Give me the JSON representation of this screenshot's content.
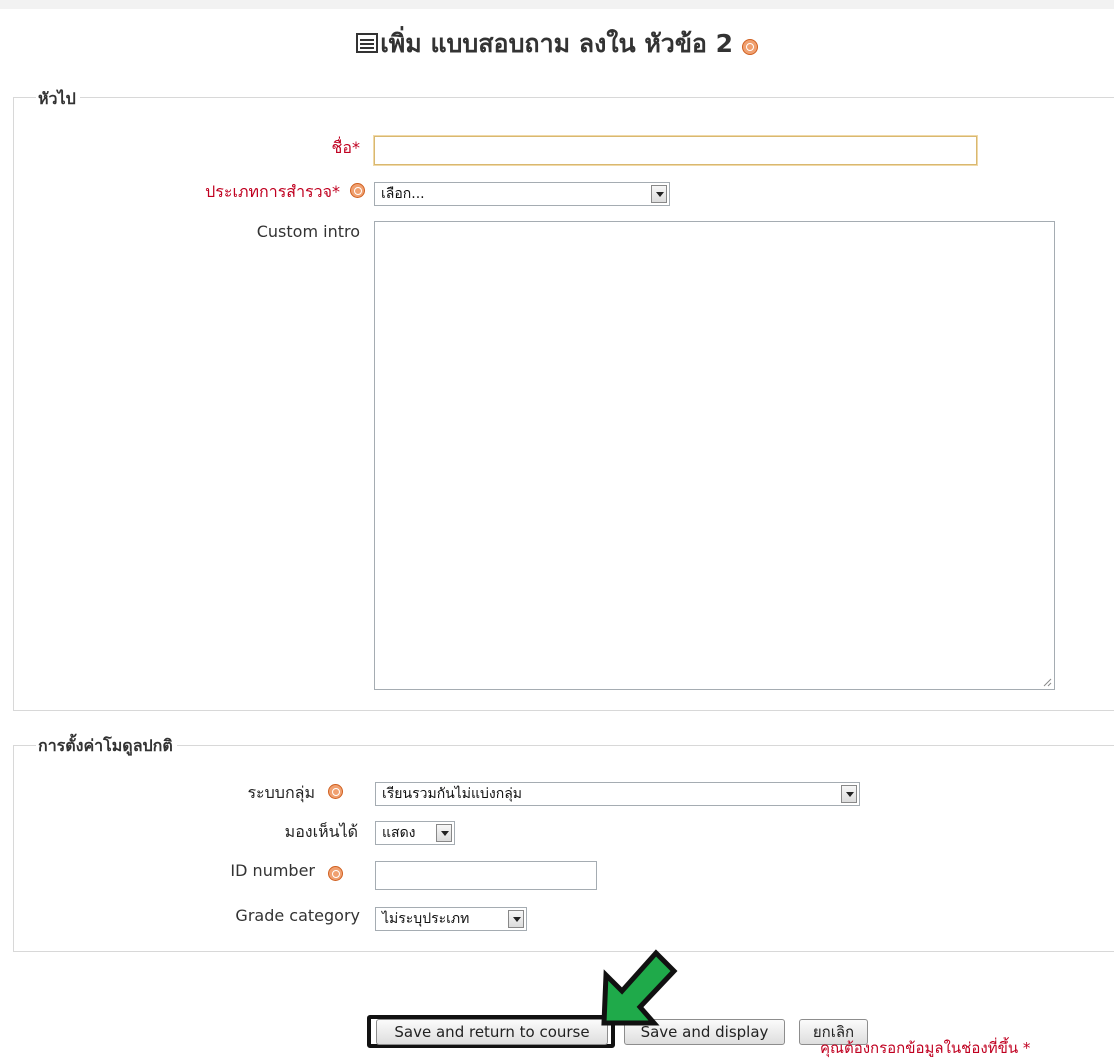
{
  "page_title": "เพิ่ม แบบสอบถาม ลงใน หัวข้อ 2",
  "sections": {
    "general": {
      "legend": "หัวไป",
      "name_label": "ชื่อ",
      "name_value": "",
      "survey_type_label": "ประเภทการสำรวจ",
      "survey_type_value": "เลือก...",
      "custom_intro_label": "Custom intro"
    },
    "module": {
      "legend": "การตั้งค่าโมดูลปกติ",
      "group_mode_label": "ระบบกลุ่ม",
      "group_mode_value": "เรียนรวมกันไม่แบ่งกลุ่ม",
      "visible_label": "มองเห็นได้",
      "visible_value": "แสดง",
      "id_number_label": "ID number",
      "id_number_value": "",
      "grade_category_label": "Grade category",
      "grade_category_value": "ไม่ระบุประเภท"
    }
  },
  "buttons": {
    "save_return": "Save and return to course",
    "save_display": "Save and display",
    "cancel": "ยกเลิก"
  },
  "required_star": "*",
  "required_note": "คุณต้องกรอกข้อมูลในช่องที่ขึ้น",
  "colors": {
    "required": "#c00020",
    "highlight_arrow": "#1faa4a",
    "help_icon": "#f0a070"
  }
}
